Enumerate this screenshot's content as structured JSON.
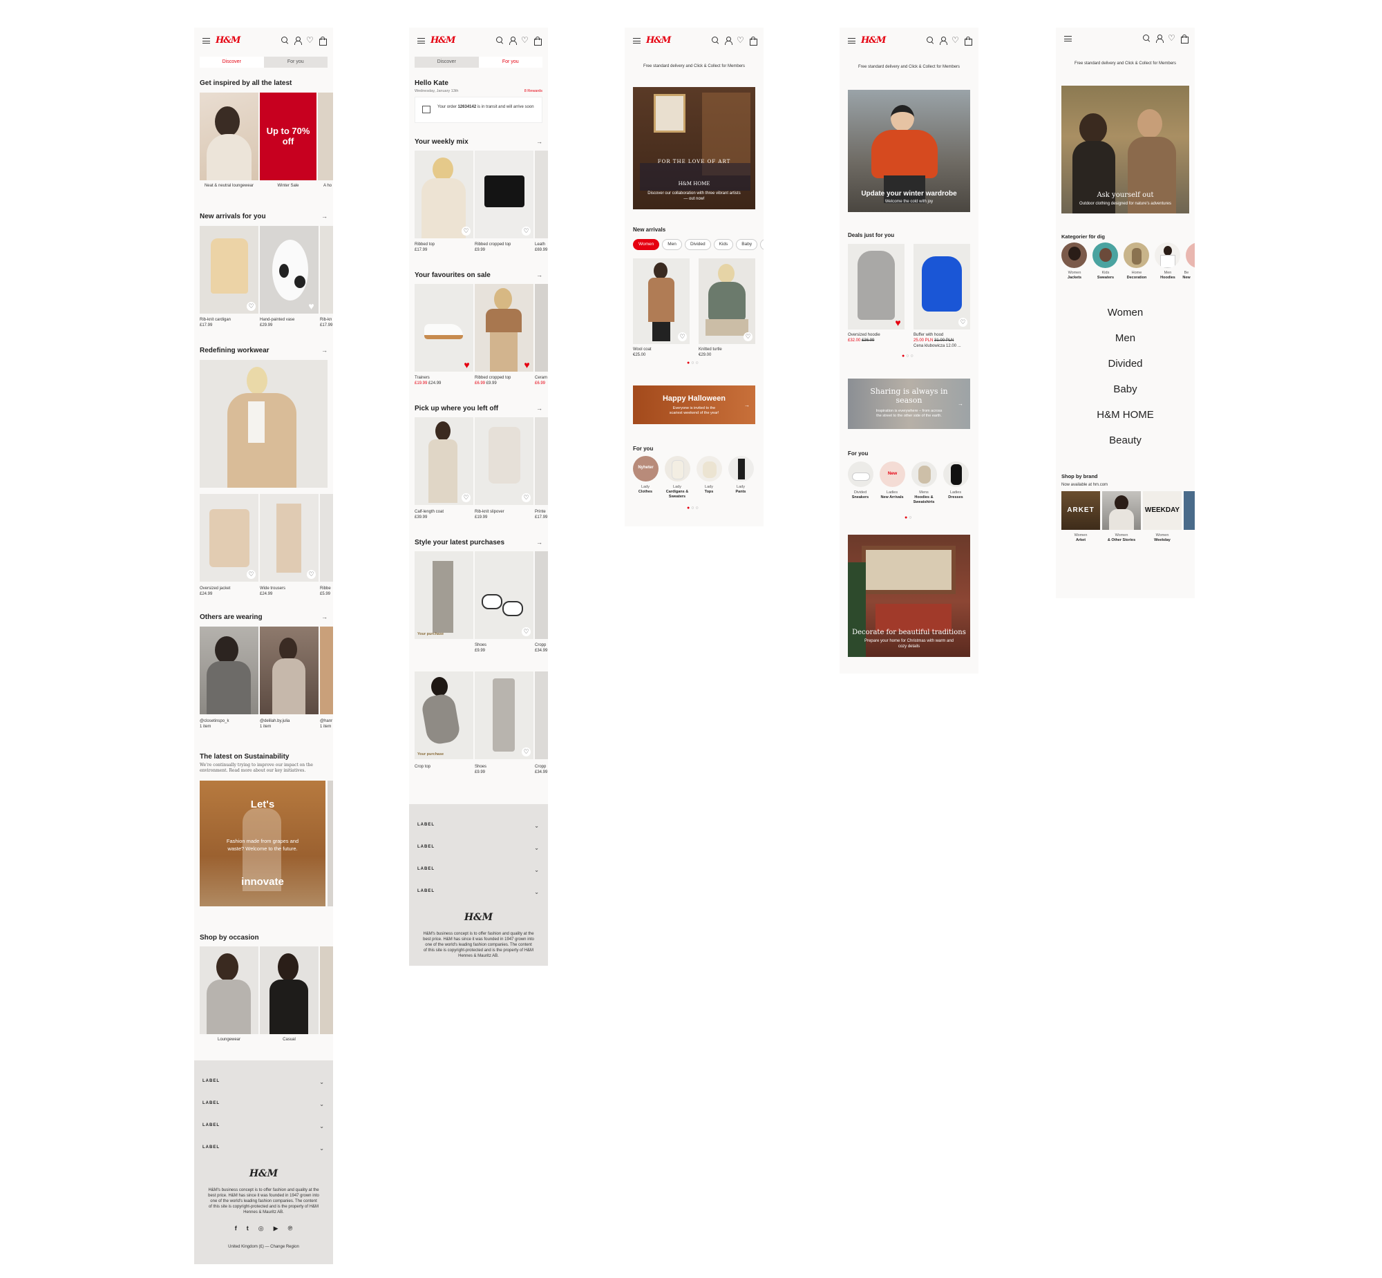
{
  "brand": {
    "logo": "H&M",
    "accent": "#e50010"
  },
  "s1": {
    "tabs": [
      "Discover",
      "For you"
    ],
    "inspired": {
      "title": "Get inspired by all the latest",
      "items": [
        "Neat & neutral loungewear",
        "Winter Sale",
        "A ho"
      ],
      "promo": "Up to 70% off"
    },
    "arrivals": {
      "title": "New arrivals for you",
      "items": [
        {
          "name": "Rib-knit cardigan",
          "price": "£17.99"
        },
        {
          "name": "Hand-painted vase",
          "price": "£29.99"
        },
        {
          "name": "Rib-kn",
          "price": "£17.99"
        }
      ]
    },
    "workwear": {
      "title": "Redefining workwear",
      "items": [
        {
          "name": "Oversized jacket",
          "price": "£24.99"
        },
        {
          "name": "Wide trousers",
          "price": "£24.99"
        },
        {
          "name": "Ribbe",
          "price": "£5.99"
        }
      ]
    },
    "wearing": {
      "title": "Others are wearing",
      "items": [
        {
          "name": "@closetinspo_k",
          "sub": "1 item"
        },
        {
          "name": "@delilah.by.julia",
          "sub": "1 item"
        },
        {
          "name": "@hanr",
          "sub": "1 item"
        }
      ]
    },
    "sustain": {
      "title": "The latest on Sustainability",
      "text": "We're continually trying to improve our impact on the environment. Read more about our key initiatives.",
      "top": "Let's",
      "mid": "Fashion made from grapes and waste? Welcome to the future.",
      "bottom": "innovate"
    },
    "occasion": {
      "title": "Shop by occasion",
      "items": [
        "Loungewear",
        "Casual"
      ]
    },
    "footer": {
      "labels": [
        "LABEL",
        "LABEL",
        "LABEL",
        "LABEL"
      ],
      "logo": "H&M",
      "text": "H&M's business concept is to offer fashion and quality at the best price. H&M has since it was founded in 1947 grown into one of the world's leading fashion companies. The content of this site is copyright-protected and is the property of H&M Hennes & Mauritz AB.",
      "region": "United Kingdom (£) — Change Region"
    }
  },
  "s2": {
    "tabs": [
      "Discover",
      "For you"
    ],
    "hello": "Hello Kate",
    "date": "Wednesday, January 13th",
    "rewards": "8 Rewards",
    "order": {
      "pre": "Your order ",
      "num": "12634142",
      "post": " is in transit and will arrive soon"
    },
    "weekly": {
      "title": "Your weekly mix",
      "items": [
        {
          "name": "Ribbed top",
          "price": "£17.99"
        },
        {
          "name": "Ribbed cropped top",
          "price": "£9.99"
        },
        {
          "name": "Leath",
          "price": "£69.99"
        }
      ]
    },
    "sale": {
      "title": "Your favourites on sale",
      "items": [
        {
          "name": "Trainers",
          "sale": "£19.99",
          "price": "£24.99"
        },
        {
          "name": "Ribbed cropped top",
          "sale": "£6.99",
          "price": "£9.99"
        },
        {
          "name": "Ceram",
          "sale": "£6.99",
          "price": ""
        }
      ]
    },
    "pickup": {
      "title": "Pick up where you left off",
      "items": [
        {
          "name": "Calf-length coat",
          "price": "£39.99"
        },
        {
          "name": "Rib-knit slipover",
          "price": "£19.99"
        },
        {
          "name": "Printe",
          "price": "£17.99"
        }
      ]
    },
    "style": {
      "title": "Style your latest purchases",
      "badge": "Your purchase",
      "row1": [
        {
          "name": "",
          "price": ""
        },
        {
          "name": "Shoes",
          "price": "£9.99"
        },
        {
          "name": "Cropp",
          "price": "£34.99"
        }
      ],
      "row2": [
        {
          "name": "Crop top",
          "price": ""
        },
        {
          "name": "Shoes",
          "price": "£9.99"
        },
        {
          "name": "Cropp",
          "price": "£34.99"
        }
      ]
    },
    "footer": {
      "labels": [
        "LABEL",
        "LABEL",
        "LABEL",
        "LABEL"
      ],
      "logo": "H&M",
      "text": "H&M's business concept is to offer fashion and quality at the best price. H&M has since it was founded in 1947 grown into one of the world's leading fashion companies. The content of this site is copyright-protected and is the property of H&M Hennes & Mauritz AB."
    }
  },
  "s3": {
    "delivery": "Free standard delivery and Click & Collect for Members",
    "hero": {
      "title": "FOR THE LOVE OF ART",
      "brand": "H&M HOME",
      "text": "Discover our collaboration with three vibrant artists — out now!"
    },
    "arrivals": {
      "title": "New arrivals",
      "chips": [
        "Women",
        "Men",
        "Divided",
        "Kids",
        "Baby",
        "H"
      ],
      "items": [
        {
          "name": "Wool coat",
          "price": "€25.00"
        },
        {
          "name": "Knitted turtle",
          "price": "€29.00"
        }
      ]
    },
    "halloween": {
      "title": "Happy Halloween",
      "text": "Everyone is invited to the scariest weekend of the year!"
    },
    "foryou": {
      "title": "For you",
      "items": [
        {
          "top": "Lady",
          "bottom": "Clothes",
          "badge": "Nyheter"
        },
        {
          "top": "Lady",
          "bottom": "Cardigans & Sweaters",
          "badge": ""
        },
        {
          "top": "Lady",
          "bottom": "Tops",
          "badge": ""
        },
        {
          "top": "Lady",
          "bottom": "Pants",
          "badge": ""
        }
      ]
    }
  },
  "s4": {
    "delivery": "Free standard delivery and Click & Collect for Members",
    "hero": {
      "title": "Update your winter wardrobe",
      "text": "Welcome the cold with joy"
    },
    "deals": {
      "title": "Deals just for you",
      "items": [
        {
          "name": "Oversized hoodie",
          "sale": "£32.00",
          "price": "£36.99",
          "extra": ""
        },
        {
          "name": "Buffer with hood",
          "sale": "25.00 PLN",
          "price": "31.00 PLN",
          "extra": "Cena klubowicza 12.00 ..."
        }
      ]
    },
    "sharing": {
      "title": "Sharing is always in season",
      "text": "Inspiration is everywhere – from across the street to the other side of the earth."
    },
    "foryou": {
      "title": "For you",
      "items": [
        {
          "top": "Divided",
          "bottom": "Sneakers",
          "badge": ""
        },
        {
          "top": "Ladies",
          "bottom": "New Arrivals",
          "badge": "New"
        },
        {
          "top": "Mens",
          "bottom": "Hoodies & Sweatshirts",
          "badge": ""
        },
        {
          "top": "Ladies",
          "bottom": "Dresses",
          "badge": ""
        }
      ]
    },
    "xmas": {
      "title": "Decorate for beautiful traditions",
      "text": "Prepare your home for Christmas with warm and cozy details"
    }
  },
  "s5": {
    "delivery": "Free standard delivery and Click & Collect for Members",
    "hero": {
      "title": "Ask yourself out",
      "text": "Outdoor clothing designed for nature's adventures"
    },
    "cats": {
      "title": "Kategorier för dig",
      "items": [
        {
          "top": "Women",
          "bottom": "Jackets"
        },
        {
          "top": "Kids",
          "bottom": "Sweaters"
        },
        {
          "top": "Home",
          "bottom": "Decoration"
        },
        {
          "top": "Men",
          "bottom": "Hoodies"
        },
        {
          "top": "Be",
          "bottom": "New"
        }
      ]
    },
    "nav": [
      "Women",
      "Men",
      "Divided",
      "Baby",
      "H&M HOME",
      "Beauty"
    ],
    "brands": {
      "title": "Shop by brand",
      "sub": "Now available at hm.com",
      "items": [
        {
          "logo": "ARKET",
          "top": "Women",
          "bottom": "Arket"
        },
        {
          "logo": "",
          "top": "Women",
          "bottom": "& Other Stories"
        },
        {
          "logo": "WEEKDAY",
          "top": "Women",
          "bottom": "Weekday"
        }
      ]
    }
  }
}
